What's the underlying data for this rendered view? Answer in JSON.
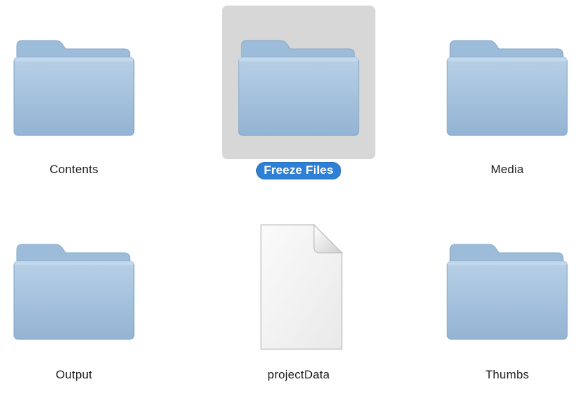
{
  "window": {
    "view": "icon-view"
  },
  "selected_index": 1,
  "items": [
    {
      "name": "Contents",
      "icon": "folder-icon",
      "selected": false
    },
    {
      "name": "Freeze Files",
      "icon": "folder-icon",
      "selected": true
    },
    {
      "name": "Media",
      "icon": "folder-icon",
      "selected": false
    },
    {
      "name": "Output",
      "icon": "folder-icon",
      "selected": false
    },
    {
      "name": "projectData",
      "icon": "document-icon",
      "selected": false
    },
    {
      "name": "Thumbs",
      "icon": "folder-icon",
      "selected": false
    }
  ],
  "colors": {
    "folder_top": "#a9c6e0",
    "folder_body": "#9bbcd9",
    "folder_edge": "#7fa3c4",
    "selection_bg": "#d7d7d7",
    "label_selected_bg": "#2e80d6"
  }
}
